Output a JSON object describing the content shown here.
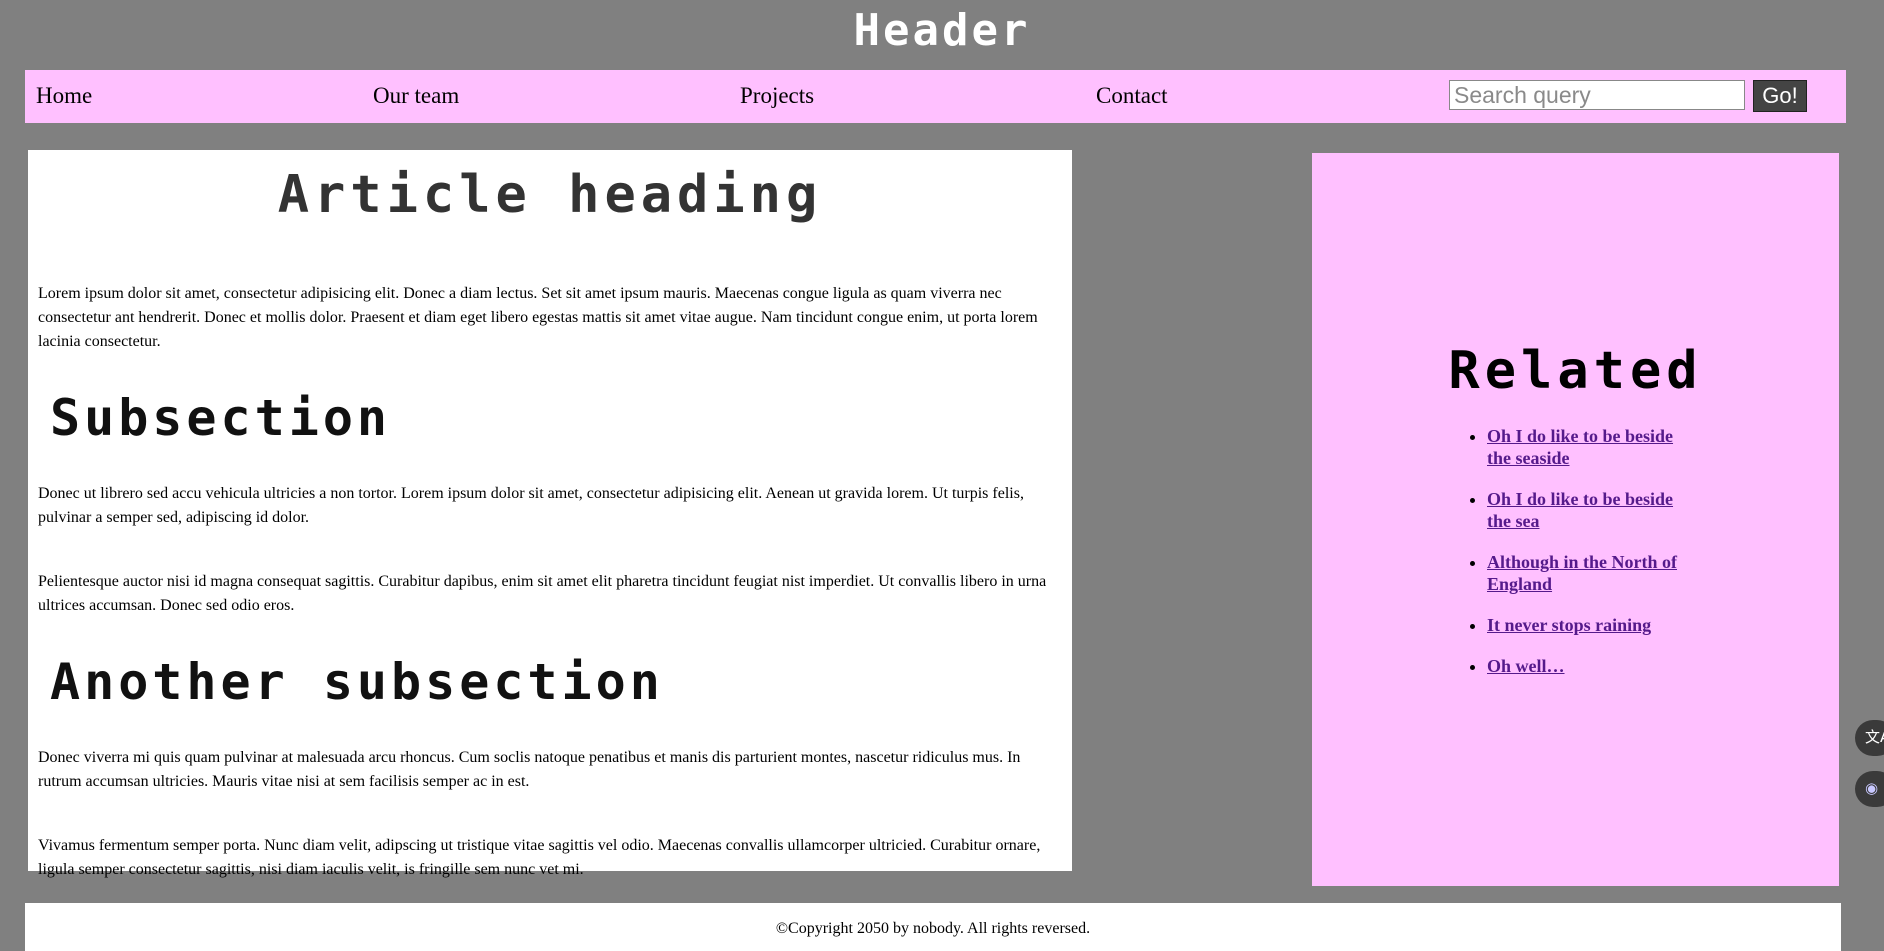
{
  "header": {
    "title": "Header"
  },
  "nav": {
    "links": [
      "Home",
      "Our team",
      "Projects",
      "Contact"
    ],
    "search_placeholder": "Search query",
    "search_value": "",
    "go_label": "Go!"
  },
  "article": {
    "heading": "Article heading",
    "intro": "Lorem ipsum dolor sit amet, consectetur adipisicing elit. Donec a diam lectus. Set sit amet ipsum mauris. Maecenas congue ligula as quam viverra nec consectetur ant hendrerit. Donec et mollis dolor. Praesent et diam eget libero egestas mattis sit amet vitae augue. Nam tincidunt congue enim, ut porta lorem lacinia consectetur.",
    "subsection": {
      "heading": "Subsection",
      "p1": "Donec ut librero sed accu vehicula ultricies a non tortor. Lorem ipsum dolor sit amet, consectetur adipisicing elit. Aenean ut gravida lorem. Ut turpis felis, pulvinar a semper sed, adipiscing id dolor.",
      "p2": "Pelientesque auctor nisi id magna consequat sagittis. Curabitur dapibus, enim sit amet elit pharetra tincidunt feugiat nist imperdiet. Ut convallis libero in urna ultrices accumsan. Donec sed odio eros."
    },
    "another_subsection": {
      "heading": "Another subsection",
      "p1": "Donec viverra mi quis quam pulvinar at malesuada arcu rhoncus. Cum soclis natoque penatibus et manis dis parturient montes, nascetur ridiculus mus. In rutrum accumsan ultricies. Mauris vitae nisi at sem facilisis semper ac in est.",
      "p2": "Vivamus fermentum semper porta. Nunc diam velit, adipscing ut tristique vitae sagittis vel odio. Maecenas convallis ullamcorper ultricied. Curabitur ornare, ligula semper consectetur sagittis, nisi diam iaculis velit, is fringille sem nunc vet mi."
    }
  },
  "sidebar": {
    "heading": "Related",
    "links": [
      "Oh I do like to be beside the seaside",
      "Oh I do like to be beside the sea",
      "Although in the North of England",
      "It never stops raining",
      "Oh well…"
    ]
  },
  "footer": {
    "text": "©Copyright 2050 by nobody. All rights reversed."
  },
  "floating_buttons": [
    {
      "icon": "translate-icon",
      "glyph": "文A"
    },
    {
      "icon": "assistant-icon",
      "glyph": "◉"
    }
  ],
  "colors": {
    "page_background": "#808080",
    "nav_background": "#ffc0ff",
    "sidebar_background": "#ffc0ff",
    "link_visited": "#551a8b"
  }
}
